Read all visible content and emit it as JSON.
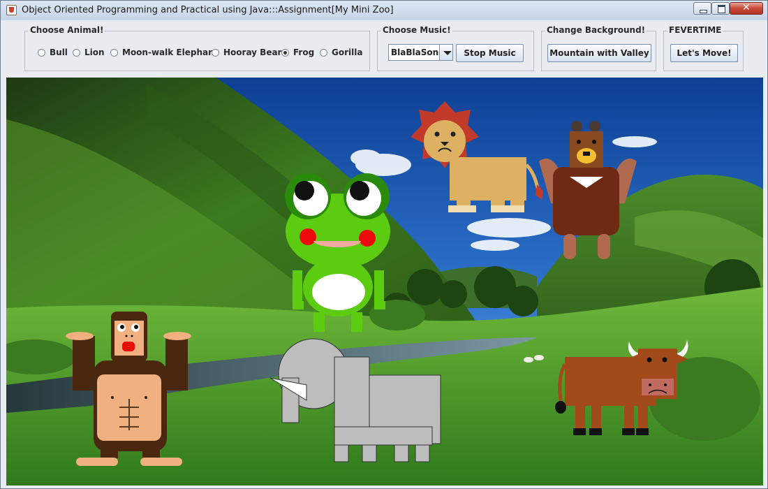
{
  "window": {
    "title": "Object Oriented Programming and Practical using Java:::Assignment[My Mini Zoo]",
    "controls": [
      "minimize",
      "maximize",
      "close"
    ]
  },
  "animal_panel": {
    "title": "Choose Animal!",
    "options": [
      {
        "label": "Bull",
        "selected": false
      },
      {
        "label": "Lion",
        "selected": false
      },
      {
        "label": "Moon-walk Elephant",
        "selected": false
      },
      {
        "label": "Hooray Bear",
        "selected": false
      },
      {
        "label": "Frog",
        "selected": true
      },
      {
        "label": "Gorilla",
        "selected": false
      }
    ]
  },
  "music_panel": {
    "title": "Choose Music!",
    "selected_song": "BlaBlaSong",
    "stop_label": "Stop Music"
  },
  "background_panel": {
    "title": "Change Background!",
    "button_label": "Mountain with Valley"
  },
  "fever_panel": {
    "title": "FEVERTIME",
    "button_label": "Let's Move!"
  },
  "scene": {
    "background": "Mountain with Valley",
    "animals": [
      "lion",
      "bear",
      "frog",
      "gorilla",
      "elephant",
      "bull"
    ]
  },
  "colors": {
    "frog_green": "#5ccc10",
    "lion_mane": "#c03030",
    "lion_body": "#ddb060",
    "bear_body": "#6a2810",
    "gorilla_fur": "#4a2810",
    "gorilla_skin": "#f0b080",
    "elephant_gray": "#bcbcbc",
    "bull_brown": "#a04818",
    "sky_blue": "#2c6bc4",
    "grass_green": "#4aa82a"
  }
}
